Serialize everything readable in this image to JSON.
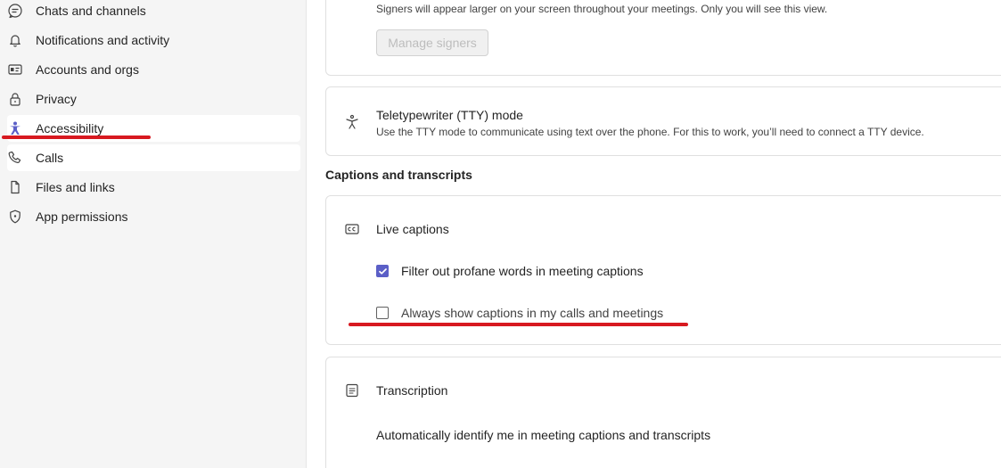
{
  "sidebar": {
    "items": [
      {
        "label": "Chats and channels",
        "icon": "chat-icon"
      },
      {
        "label": "Notifications and activity",
        "icon": "bell-icon"
      },
      {
        "label": "Accounts and orgs",
        "icon": "id-card-icon"
      },
      {
        "label": "Privacy",
        "icon": "lock-icon"
      },
      {
        "label": "Accessibility",
        "icon": "accessibility-icon",
        "selected": true
      },
      {
        "label": "Calls",
        "icon": "phone-icon"
      },
      {
        "label": "Files and links",
        "icon": "document-icon"
      },
      {
        "label": "App permissions",
        "icon": "shield-icon"
      }
    ]
  },
  "accessibility": {
    "signers": {
      "description": "Signers will appear larger on your screen throughout your meetings. Only you will see this view.",
      "manage_button": "Manage signers"
    },
    "tty": {
      "title": "Teletypewriter (TTY) mode",
      "description": "Use the TTY mode to communicate using text over the phone. For this to work, you’ll need to connect a TTY device."
    }
  },
  "captions_transcripts": {
    "heading": "Captions and transcripts",
    "live_captions": {
      "title": "Live captions",
      "options": [
        {
          "label": "Filter out profane words in meeting captions",
          "checked": true
        },
        {
          "label": "Always show captions in my calls and meetings",
          "checked": false
        }
      ]
    },
    "transcription": {
      "title": "Transcription",
      "description": "Automatically identify me in meeting captions and transcripts"
    }
  },
  "colors": {
    "accent": "#5b5fc7",
    "annotation": "#d71920",
    "sidebar_bg": "#f5f5f5"
  }
}
